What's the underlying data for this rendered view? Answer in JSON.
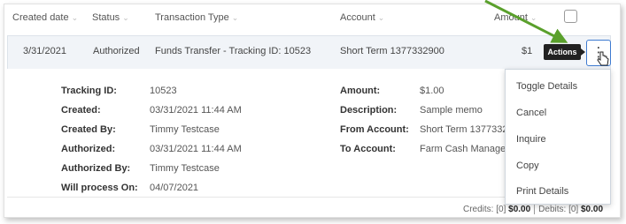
{
  "header": {
    "col_created": "Created date",
    "col_status": "Status",
    "col_type": "Transaction Type",
    "col_account": "Account",
    "col_amount": "Amount",
    "sort_caret": "⌄"
  },
  "row": {
    "date": "3/31/2021",
    "status": "Authorized",
    "type": "Funds Transfer - Tracking ID: 10523",
    "account": "Short Term 1377332900",
    "amount": "$1",
    "actions_tooltip": "Actions",
    "kebab_icon": "⋮"
  },
  "details": {
    "left": [
      {
        "label": "Tracking ID:",
        "value": "10523"
      },
      {
        "label": "Created:",
        "value": "03/31/2021 11:44 AM"
      },
      {
        "label": "Created By:",
        "value": "Timmy Testcase"
      },
      {
        "label": "Authorized:",
        "value": "03/31/2021 11:44 AM"
      },
      {
        "label": "Authorized By:",
        "value": "Timmy Testcase"
      },
      {
        "label": "Will process On:",
        "value": "04/07/2021"
      }
    ],
    "right": [
      {
        "label": "Amount:",
        "value": "$1.00"
      },
      {
        "label": "Description:",
        "value": "Sample memo"
      },
      {
        "label": "From Account:",
        "value": "Short Term 1377332"
      },
      {
        "label": "To Account:",
        "value": "Farm Cash Manager"
      }
    ]
  },
  "menu": [
    "Toggle Details",
    "Cancel",
    "Inquire",
    "Copy",
    "Print Details"
  ],
  "footer": {
    "credits_label": "Credits: [0]",
    "credits_value": "$0.00",
    "debits_label": "Debits: [0]",
    "debits_value": "$0.00"
  },
  "colors": {
    "arrow": "#5aa02c",
    "row_bg": "#f1f4f8",
    "kebab_border": "#3e7bd1"
  }
}
